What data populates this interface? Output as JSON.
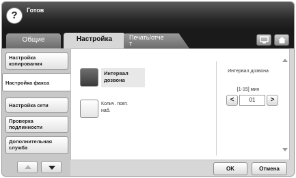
{
  "app": {
    "title": "Готов",
    "help_label": "?"
  },
  "tabs": {
    "general": "Общие",
    "settings": "Настройка",
    "print": "Печать/отче\nт"
  },
  "sidebar": {
    "items": [
      {
        "label": "Настройка\nкопирования"
      },
      {
        "label": "Настройка факса"
      },
      {
        "label": "Настройка сети"
      },
      {
        "label": "Проверка\nподлинности"
      },
      {
        "label": "Дополнительная\nслужба"
      }
    ],
    "active_index": 1
  },
  "options": {
    "redial_interval": "Интервал\nдозвона",
    "redial_count": "Колич. повт.\nнаб."
  },
  "stepper": {
    "title": "Интервал дозвона",
    "range": "[1-15] мин",
    "value": "01",
    "dec": "<",
    "inc": ">"
  },
  "buttons": {
    "ok": "OK",
    "cancel": "Отмена"
  },
  "colors": {
    "titlebar": "#1a1a1a",
    "selected_option": "#4a4a4a",
    "panel": "#ffffff"
  }
}
